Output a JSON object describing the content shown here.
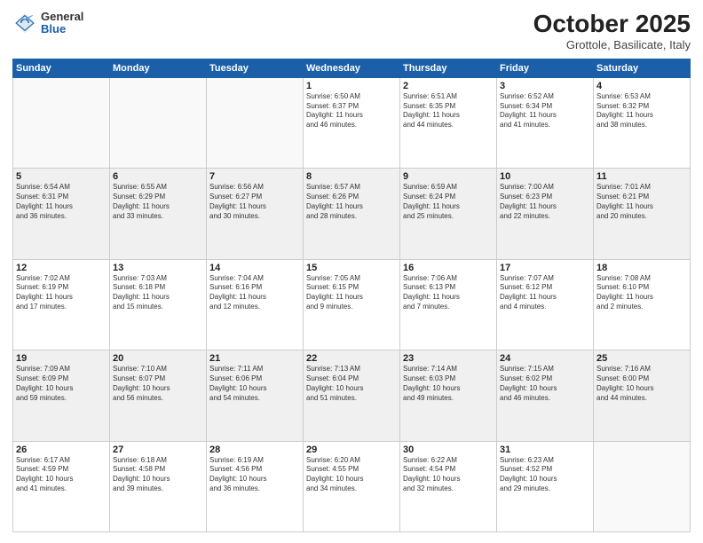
{
  "header": {
    "logo_general": "General",
    "logo_blue": "Blue",
    "month": "October 2025",
    "location": "Grottole, Basilicate, Italy"
  },
  "days_of_week": [
    "Sunday",
    "Monday",
    "Tuesday",
    "Wednesday",
    "Thursday",
    "Friday",
    "Saturday"
  ],
  "weeks": [
    [
      {
        "day": "",
        "info": "",
        "empty": true
      },
      {
        "day": "",
        "info": "",
        "empty": true
      },
      {
        "day": "",
        "info": "",
        "empty": true
      },
      {
        "day": "1",
        "info": "Sunrise: 6:50 AM\nSunset: 6:37 PM\nDaylight: 11 hours\nand 46 minutes."
      },
      {
        "day": "2",
        "info": "Sunrise: 6:51 AM\nSunset: 6:35 PM\nDaylight: 11 hours\nand 44 minutes."
      },
      {
        "day": "3",
        "info": "Sunrise: 6:52 AM\nSunset: 6:34 PM\nDaylight: 11 hours\nand 41 minutes."
      },
      {
        "day": "4",
        "info": "Sunrise: 6:53 AM\nSunset: 6:32 PM\nDaylight: 11 hours\nand 38 minutes."
      }
    ],
    [
      {
        "day": "5",
        "info": "Sunrise: 6:54 AM\nSunset: 6:31 PM\nDaylight: 11 hours\nand 36 minutes."
      },
      {
        "day": "6",
        "info": "Sunrise: 6:55 AM\nSunset: 6:29 PM\nDaylight: 11 hours\nand 33 minutes."
      },
      {
        "day": "7",
        "info": "Sunrise: 6:56 AM\nSunset: 6:27 PM\nDaylight: 11 hours\nand 30 minutes."
      },
      {
        "day": "8",
        "info": "Sunrise: 6:57 AM\nSunset: 6:26 PM\nDaylight: 11 hours\nand 28 minutes."
      },
      {
        "day": "9",
        "info": "Sunrise: 6:59 AM\nSunset: 6:24 PM\nDaylight: 11 hours\nand 25 minutes."
      },
      {
        "day": "10",
        "info": "Sunrise: 7:00 AM\nSunset: 6:23 PM\nDaylight: 11 hours\nand 22 minutes."
      },
      {
        "day": "11",
        "info": "Sunrise: 7:01 AM\nSunset: 6:21 PM\nDaylight: 11 hours\nand 20 minutes."
      }
    ],
    [
      {
        "day": "12",
        "info": "Sunrise: 7:02 AM\nSunset: 6:19 PM\nDaylight: 11 hours\nand 17 minutes."
      },
      {
        "day": "13",
        "info": "Sunrise: 7:03 AM\nSunset: 6:18 PM\nDaylight: 11 hours\nand 15 minutes."
      },
      {
        "day": "14",
        "info": "Sunrise: 7:04 AM\nSunset: 6:16 PM\nDaylight: 11 hours\nand 12 minutes."
      },
      {
        "day": "15",
        "info": "Sunrise: 7:05 AM\nSunset: 6:15 PM\nDaylight: 11 hours\nand 9 minutes."
      },
      {
        "day": "16",
        "info": "Sunrise: 7:06 AM\nSunset: 6:13 PM\nDaylight: 11 hours\nand 7 minutes."
      },
      {
        "day": "17",
        "info": "Sunrise: 7:07 AM\nSunset: 6:12 PM\nDaylight: 11 hours\nand 4 minutes."
      },
      {
        "day": "18",
        "info": "Sunrise: 7:08 AM\nSunset: 6:10 PM\nDaylight: 11 hours\nand 2 minutes."
      }
    ],
    [
      {
        "day": "19",
        "info": "Sunrise: 7:09 AM\nSunset: 6:09 PM\nDaylight: 10 hours\nand 59 minutes."
      },
      {
        "day": "20",
        "info": "Sunrise: 7:10 AM\nSunset: 6:07 PM\nDaylight: 10 hours\nand 56 minutes."
      },
      {
        "day": "21",
        "info": "Sunrise: 7:11 AM\nSunset: 6:06 PM\nDaylight: 10 hours\nand 54 minutes."
      },
      {
        "day": "22",
        "info": "Sunrise: 7:13 AM\nSunset: 6:04 PM\nDaylight: 10 hours\nand 51 minutes."
      },
      {
        "day": "23",
        "info": "Sunrise: 7:14 AM\nSunset: 6:03 PM\nDaylight: 10 hours\nand 49 minutes."
      },
      {
        "day": "24",
        "info": "Sunrise: 7:15 AM\nSunset: 6:02 PM\nDaylight: 10 hours\nand 46 minutes."
      },
      {
        "day": "25",
        "info": "Sunrise: 7:16 AM\nSunset: 6:00 PM\nDaylight: 10 hours\nand 44 minutes."
      }
    ],
    [
      {
        "day": "26",
        "info": "Sunrise: 6:17 AM\nSunset: 4:59 PM\nDaylight: 10 hours\nand 41 minutes."
      },
      {
        "day": "27",
        "info": "Sunrise: 6:18 AM\nSunset: 4:58 PM\nDaylight: 10 hours\nand 39 minutes."
      },
      {
        "day": "28",
        "info": "Sunrise: 6:19 AM\nSunset: 4:56 PM\nDaylight: 10 hours\nand 36 minutes."
      },
      {
        "day": "29",
        "info": "Sunrise: 6:20 AM\nSunset: 4:55 PM\nDaylight: 10 hours\nand 34 minutes."
      },
      {
        "day": "30",
        "info": "Sunrise: 6:22 AM\nSunset: 4:54 PM\nDaylight: 10 hours\nand 32 minutes."
      },
      {
        "day": "31",
        "info": "Sunrise: 6:23 AM\nSunset: 4:52 PM\nDaylight: 10 hours\nand 29 minutes."
      },
      {
        "day": "",
        "info": "",
        "empty": true
      }
    ]
  ]
}
